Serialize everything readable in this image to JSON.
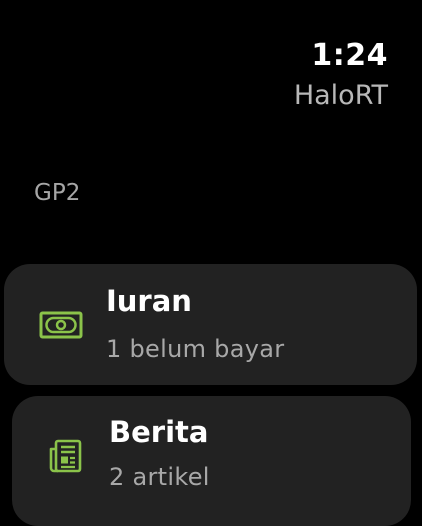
{
  "status": {
    "time": "1:24",
    "app_title": "HaloRT"
  },
  "section": {
    "label": "GP2"
  },
  "cards": [
    {
      "title": "Iuran",
      "subtitle": "1 belum bayar",
      "icon": "money-bill-icon"
    },
    {
      "title": "Berita",
      "subtitle": "2 artikel",
      "icon": "newspaper-icon"
    }
  ],
  "colors": {
    "background": "#000000",
    "card_background": "#222222",
    "icon_accent": "#8bc34a",
    "primary_text": "#ffffff",
    "secondary_text": "#a8a8a8"
  }
}
